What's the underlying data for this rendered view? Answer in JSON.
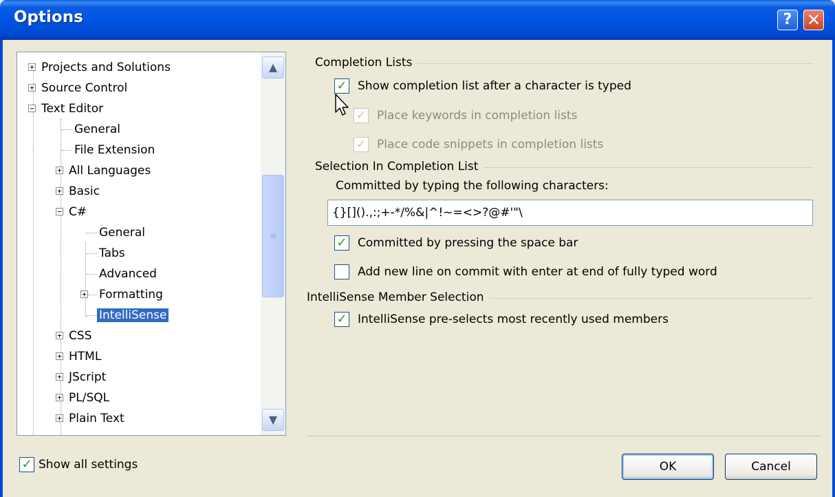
{
  "window": {
    "title": "Options",
    "help_label": "?",
    "close_label": "✕"
  },
  "tree": {
    "nodes": [
      {
        "label": "Projects and Solutions",
        "expander": "+"
      },
      {
        "label": "Source Control",
        "expander": "+"
      },
      {
        "label": "Text Editor",
        "expander": "−"
      },
      {
        "label": "General"
      },
      {
        "label": "File Extension"
      },
      {
        "label": "All Languages",
        "expander": "+"
      },
      {
        "label": "Basic",
        "expander": "+"
      },
      {
        "label": "C#",
        "expander": "−"
      },
      {
        "label": "General"
      },
      {
        "label": "Tabs"
      },
      {
        "label": "Advanced"
      },
      {
        "label": "Formatting",
        "expander": "+"
      },
      {
        "label": "IntelliSense",
        "selected": true
      },
      {
        "label": "CSS",
        "expander": "+"
      },
      {
        "label": "HTML",
        "expander": "+"
      },
      {
        "label": "JScript",
        "expander": "+"
      },
      {
        "label": "PL/SQL",
        "expander": "+"
      },
      {
        "label": "Plain Text",
        "expander": "+"
      }
    ],
    "scroll_up_icon": "▲",
    "scroll_down_icon": "▼",
    "scroll_grip": "≡"
  },
  "completion_lists": {
    "title": "Completion Lists",
    "show_after_char": {
      "label": "Show completion list after a character is typed",
      "checked": true
    },
    "place_keywords": {
      "label": "Place keywords in completion lists",
      "checked": true,
      "disabled": true
    },
    "place_snippets": {
      "label": "Place code snippets in completion lists",
      "checked": true,
      "disabled": true
    }
  },
  "selection": {
    "title": "Selection In Completion List",
    "committed_chars_label": "Committed by typing the following characters:",
    "committed_chars_value": "{}[]().,:;+-*/%&|^!~=<>?@#'\"\\",
    "space_bar": {
      "label": "Committed by pressing the space bar",
      "checked": true
    },
    "new_line": {
      "label": "Add new line on commit with enter at end of fully typed word",
      "checked": false
    }
  },
  "member_selection": {
    "title": "IntelliSense Member Selection",
    "preselect": {
      "label": "IntelliSense pre-selects most recently used members",
      "checked": true
    }
  },
  "footer": {
    "show_all": {
      "label": "Show all settings",
      "checked": true
    },
    "ok_label": "OK",
    "cancel_label": "Cancel"
  },
  "check_glyph": "✓",
  "colors": {
    "title_bar": "#0054e3",
    "selection": "#316ac5",
    "check": "#21a121",
    "dialog_bg": "#ece9d8"
  }
}
